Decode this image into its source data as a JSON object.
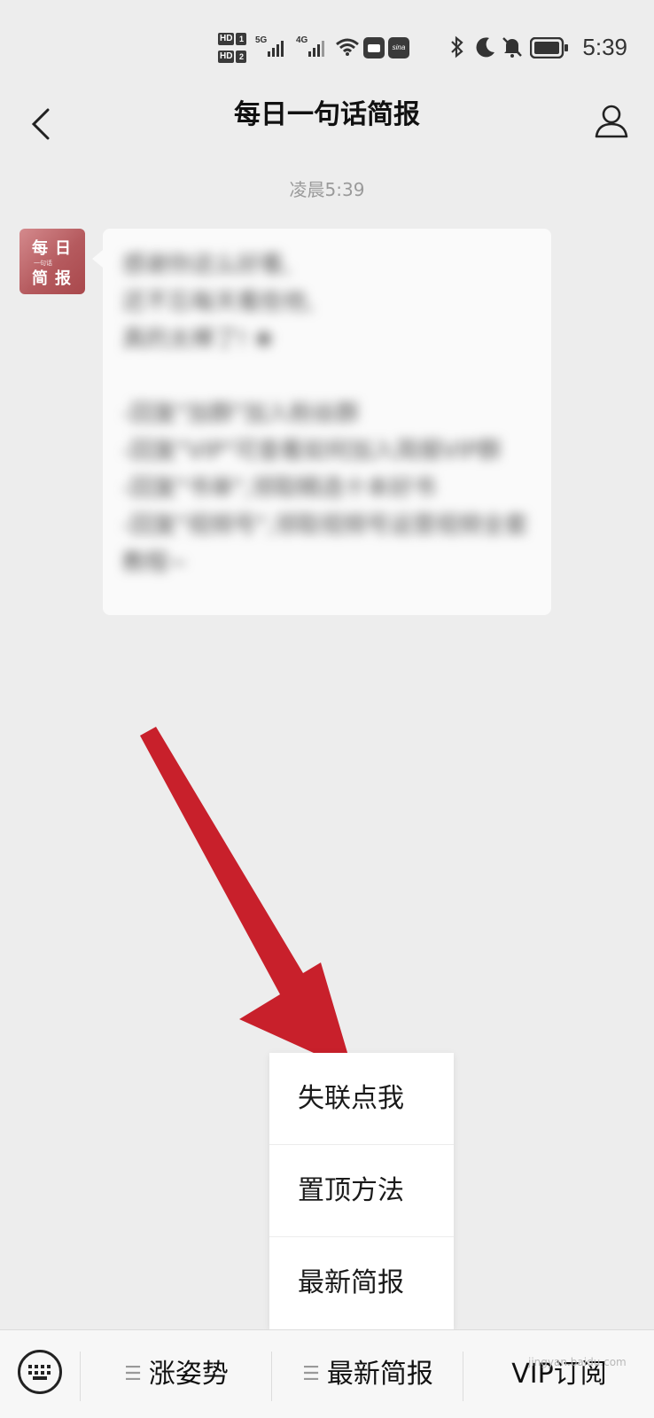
{
  "status_bar": {
    "hd1": "HD",
    "hd1_num": "1",
    "hd2": "HD",
    "hd2_num": "2",
    "net1": "5G",
    "net2": "4G",
    "sina_label": "sina",
    "time": "5:39"
  },
  "header": {
    "title": "每日一句话简报"
  },
  "chat": {
    "timestamp": "凌晨5:39",
    "avatar": {
      "char1": "每",
      "char2": "日",
      "char3": "简",
      "char4": "报",
      "small": "一句话"
    },
    "message": "感谢你这么好看,\n还不忘每天看些他,\n真的太棒了! ❀\n\n-回复\"加群\"加入粉丝群\n-回复\"VIP\"可查看如何加入简报VIP群\n-回复\"书单\",领取精选十本好书\n-回复\"视频号\",领取视频号运营视频全套教程~"
  },
  "popup_menu": {
    "items": [
      "失联点我",
      "置顶方法",
      "最新简报"
    ]
  },
  "bottom_bar": {
    "menus": [
      "涨姿势",
      "最新简报",
      "VIP订阅"
    ]
  },
  "colors": {
    "background": "#ededed",
    "bubble": "#fafafa",
    "arrow": "#c8202b",
    "avatar": "#b55a5e"
  },
  "watermark": "jingyan.baidu.com"
}
